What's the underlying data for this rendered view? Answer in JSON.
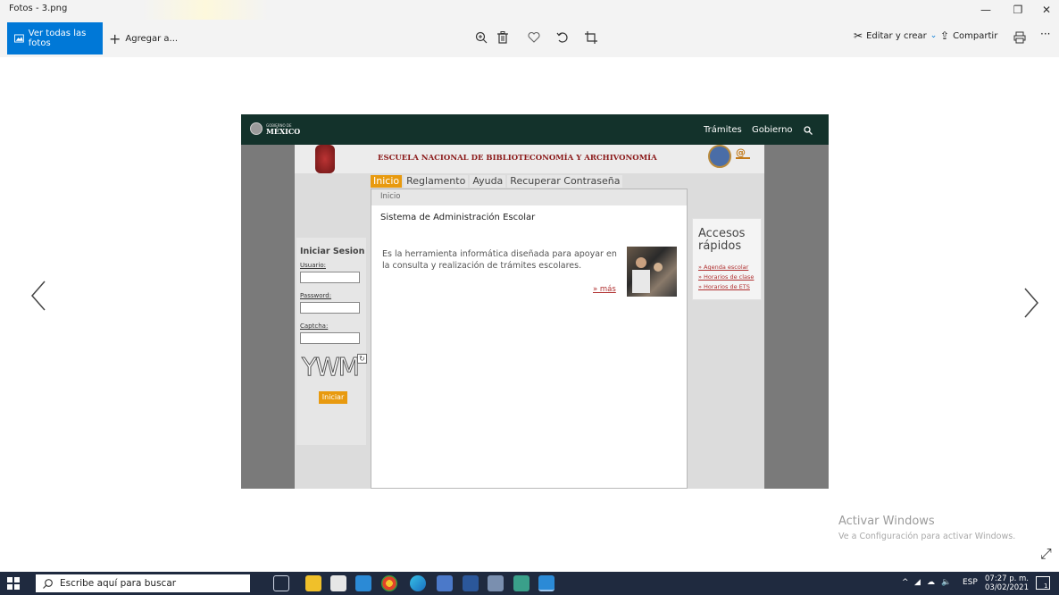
{
  "window": {
    "title": "Fotos - 3.png",
    "controls": {
      "minimize": "—",
      "restore": "❐",
      "close": "✕"
    }
  },
  "toolbar": {
    "view_all": "Ver todas las fotos",
    "add_to": "Agregar a...",
    "edit_create": "Editar y crear",
    "share": "Compartir",
    "more": "···"
  },
  "photo": {
    "gov_header": {
      "logo_small": "GOBIERNO DE",
      "logo_large": "MÉXICO",
      "links": [
        "Trámites",
        "Gobierno"
      ]
    },
    "banner_title": "ESCUELA NACIONAL DE BIBLIOTECONOMÍA Y ARCHIVONOMÍA",
    "menu": [
      "Inicio",
      "Reglamento",
      "Ayuda",
      "Recuperar Contraseña"
    ],
    "breadcrumb": "Inicio",
    "system_title": "Sistema de Administración Escolar",
    "description": "Es la herramienta informática diseñada para apoyar en la consulta y realización de trámites escolares.",
    "more_link": "» más",
    "login": {
      "title": "Iniciar Sesion",
      "user_label": "Usuario:",
      "password_label": "Password:",
      "captcha_label": "Captcha:",
      "captcha_text": "YWM",
      "submit": "Iniciar"
    },
    "quick_access": {
      "title": "Accesos rápidos",
      "links": [
        "» Agenda escolar",
        "» Horarios de clase",
        "» Horarios de ETS"
      ]
    }
  },
  "watermark": {
    "line1": "Activar Windows",
    "line2": "Ve a Configuración para activar Windows."
  },
  "taskbar": {
    "search_placeholder": "Escribe aquí para buscar",
    "language": "ESP",
    "time": "07:27 p. m.",
    "date": "03/02/2021",
    "notifications": "1"
  }
}
